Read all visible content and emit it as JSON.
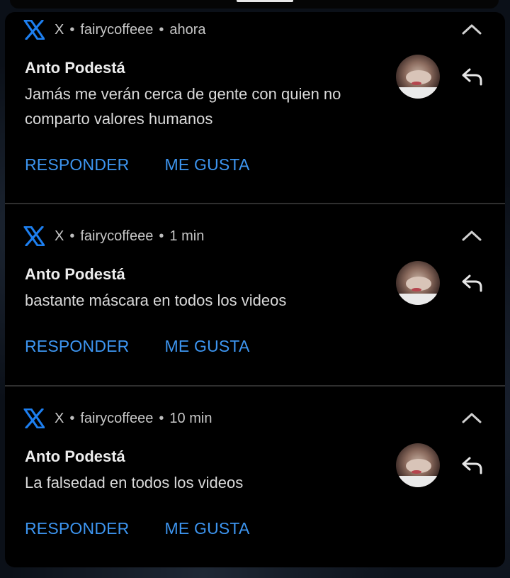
{
  "colors": {
    "panel_bg": "#000000",
    "text_primary": "#ededed",
    "text_secondary": "#c7c7c7",
    "action_blue": "#3d95f0",
    "x_logo_blue": "#1d7ff0"
  },
  "notifications": [
    {
      "app_icon": "x-logo-icon",
      "app": "X",
      "account": "fairycoffeee",
      "time": "ahora",
      "sender": "Anto Podestá",
      "text": "Jamás me verán cerca de gente con quien no comparto valores humanos",
      "actions": {
        "reply": "RESPONDER",
        "like": "ME GUSTA"
      }
    },
    {
      "app_icon": "x-logo-icon",
      "app": "X",
      "account": "fairycoffeee",
      "time": "1 min",
      "sender": "Anto Podestá",
      "text": "bastante máscara en todos los videos",
      "actions": {
        "reply": "RESPONDER",
        "like": "ME GUSTA"
      }
    },
    {
      "app_icon": "x-logo-icon",
      "app": "X",
      "account": "fairycoffeee",
      "time": "10 min",
      "sender": "Anto Podestá",
      "text": "La falsedad en todos los videos",
      "actions": {
        "reply": "RESPONDER",
        "like": "ME GUSTA"
      }
    }
  ]
}
